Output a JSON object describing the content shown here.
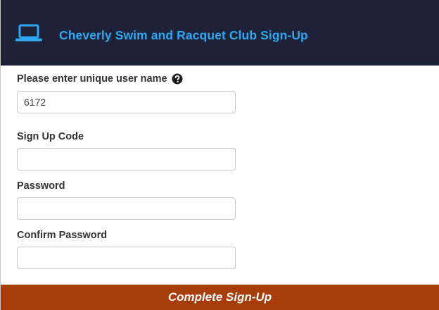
{
  "colors": {
    "header_bg": "#1e2238",
    "accent": "#2ea7f0",
    "button_bg": "#a63d0a"
  },
  "header": {
    "icon": "laptop-icon",
    "title": "Cheverly Swim and Racquet Club Sign-Up"
  },
  "form": {
    "username": {
      "label": "Please enter unique user name",
      "help_icon": "question-circle-icon",
      "value": "6172"
    },
    "signup_code": {
      "label": "Sign Up Code",
      "value": ""
    },
    "password": {
      "label": "Password",
      "value": ""
    },
    "confirm_password": {
      "label": "Confirm Password",
      "value": ""
    },
    "submit_label": "Complete Sign-Up"
  }
}
